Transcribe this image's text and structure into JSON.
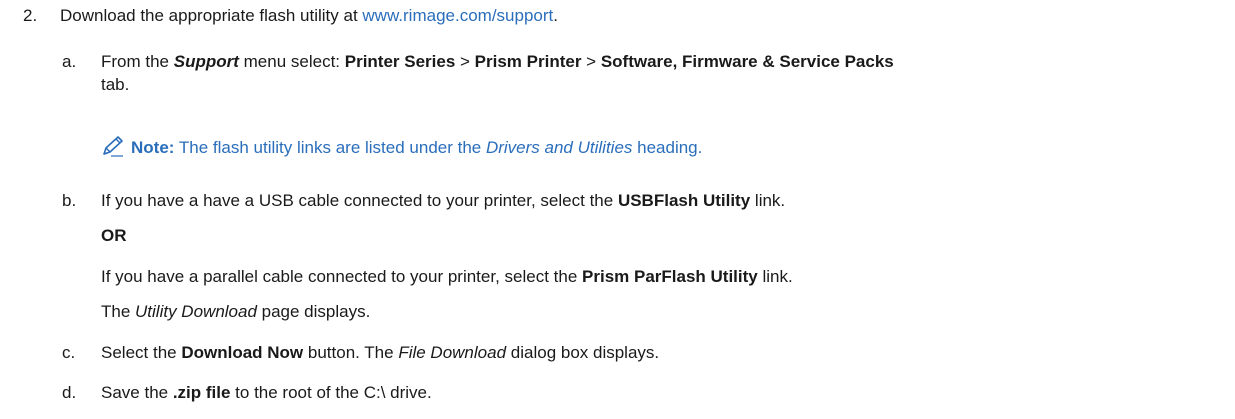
{
  "step2": {
    "number": "2.",
    "text_before": "Download the appropriate flash utility at ",
    "link": "www.rimage.com/support",
    "text_after": "."
  },
  "step_a": {
    "letter": "a.",
    "t1": "From the ",
    "support": "Support",
    "t2": " menu select: ",
    "printer_series": "Printer Series",
    "sep1": " > ",
    "prism_printer": "Prism Printer",
    "sep2": " > ",
    "tab_name": "Software, Firmware & Service Packs",
    "tab_word": "tab."
  },
  "note": {
    "icon": "pencil-icon",
    "label": "Note:",
    "t1": " The flash utility links are listed under the ",
    "heading": "Drivers and Utilities",
    "t2": " heading."
  },
  "step_b": {
    "letter": "b.",
    "t1": "If you have a have a USB cable connected to your printer, select the ",
    "usbflash": "USBFlash Utility",
    "t2": " link.",
    "or": "OR",
    "p_t1": "If you have a parallel cable connected to your printer, select the ",
    "parflash": "Prism ParFlash Utility",
    "p_t2": " link.",
    "d_page": "Utility Download",
    "d_t": " page displays.",
    "d_prefix": "The "
  },
  "step_c": {
    "letter": "c.",
    "t1": "Select the ",
    "button": "Download Now",
    "t2": " button. The ",
    "dialog": "File Download",
    "t3": " dialog box displays."
  },
  "step_d": {
    "letter": "d.",
    "t1": "Save the ",
    "file": ".zip file",
    "t2": " to the root of the C:\\ drive."
  }
}
